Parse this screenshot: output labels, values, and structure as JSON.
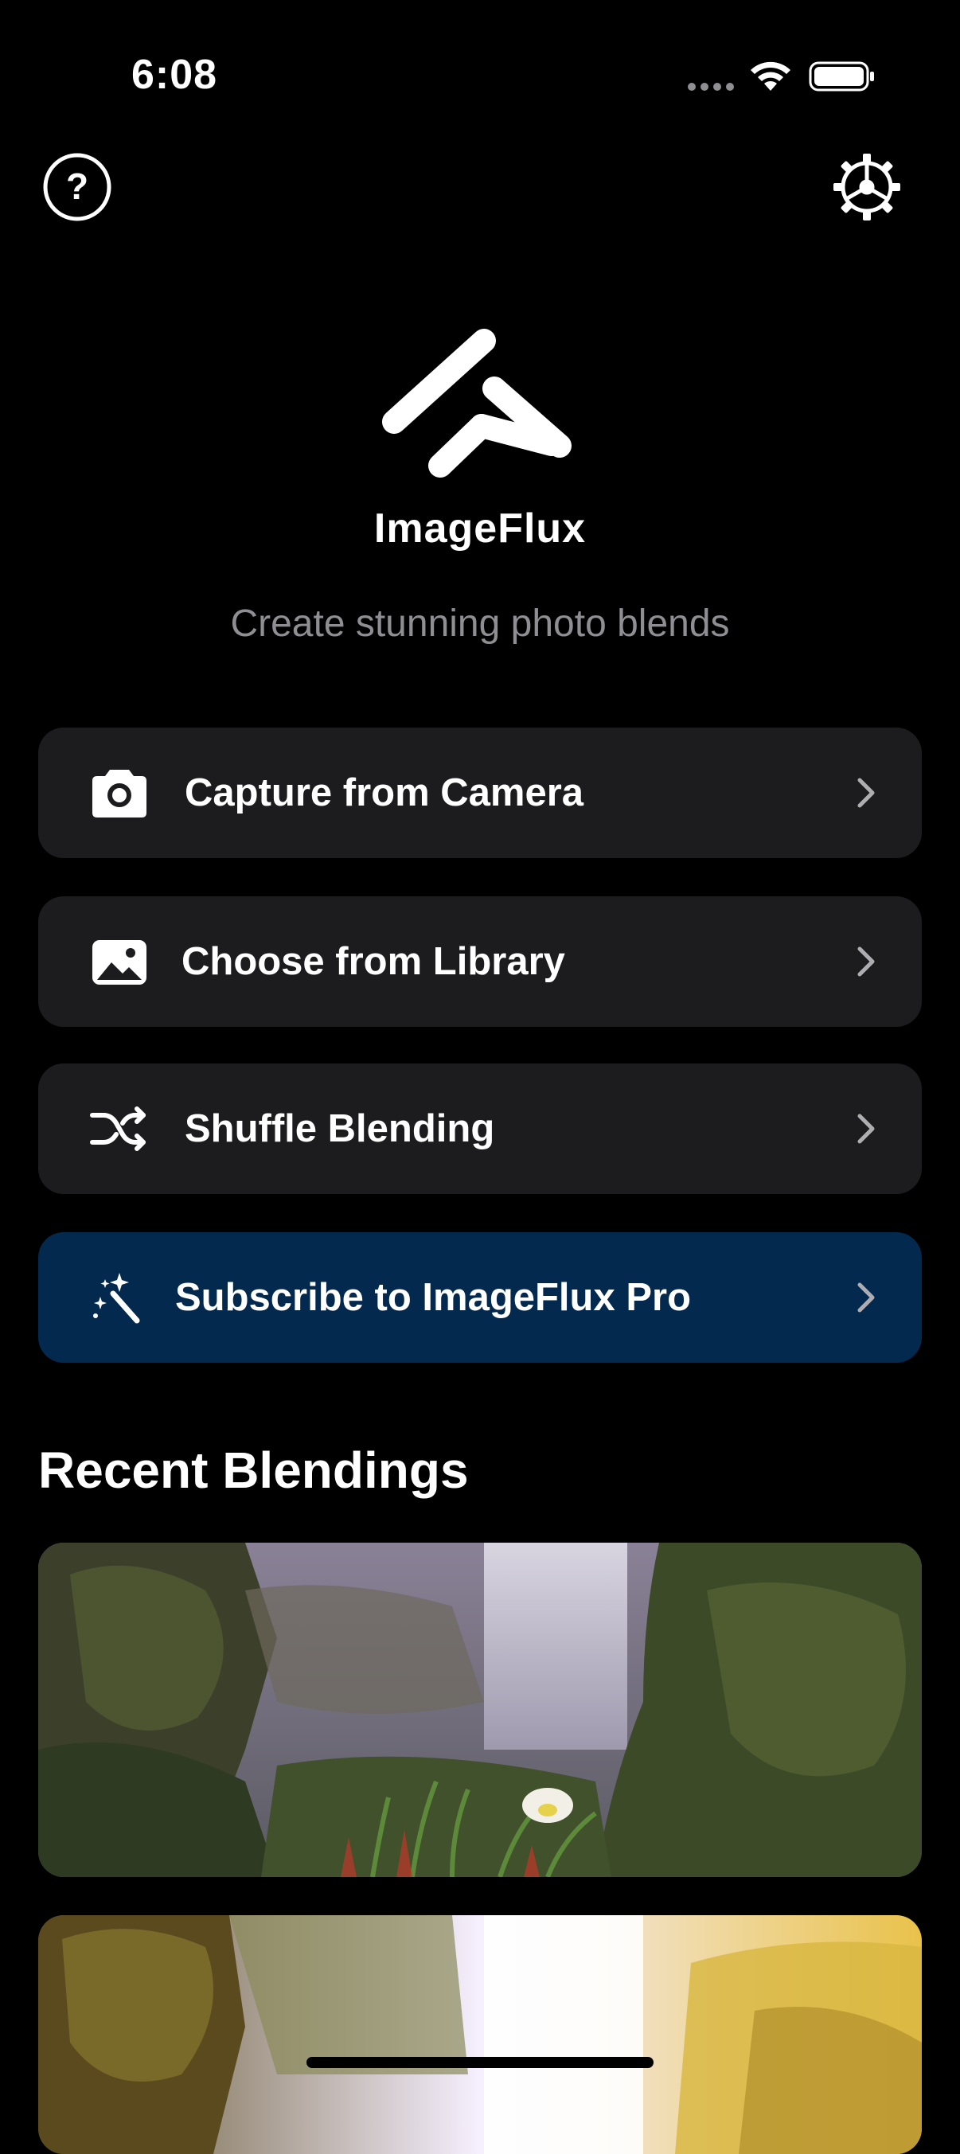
{
  "status_bar": {
    "time": "6:08"
  },
  "header": {
    "help_icon": "help-circle-icon",
    "settings_icon": "gear-icon"
  },
  "brand": {
    "name": "ImageFlux",
    "tagline": "Create stunning photo blends"
  },
  "actions": [
    {
      "label": "Capture from Camera",
      "icon": "camera-icon"
    },
    {
      "label": "Choose from Library",
      "icon": "photo-icon"
    },
    {
      "label": "Shuffle Blending",
      "icon": "shuffle-icon"
    },
    {
      "label": "Subscribe to ImageFlux Pro",
      "icon": "magic-wand-icon"
    }
  ],
  "recent": {
    "title": "Recent Blendings"
  },
  "colors": {
    "background": "#000000",
    "row_background": "#1c1c1e",
    "pro_row_background": "#03294f",
    "secondary_text": "#8e8e93"
  }
}
